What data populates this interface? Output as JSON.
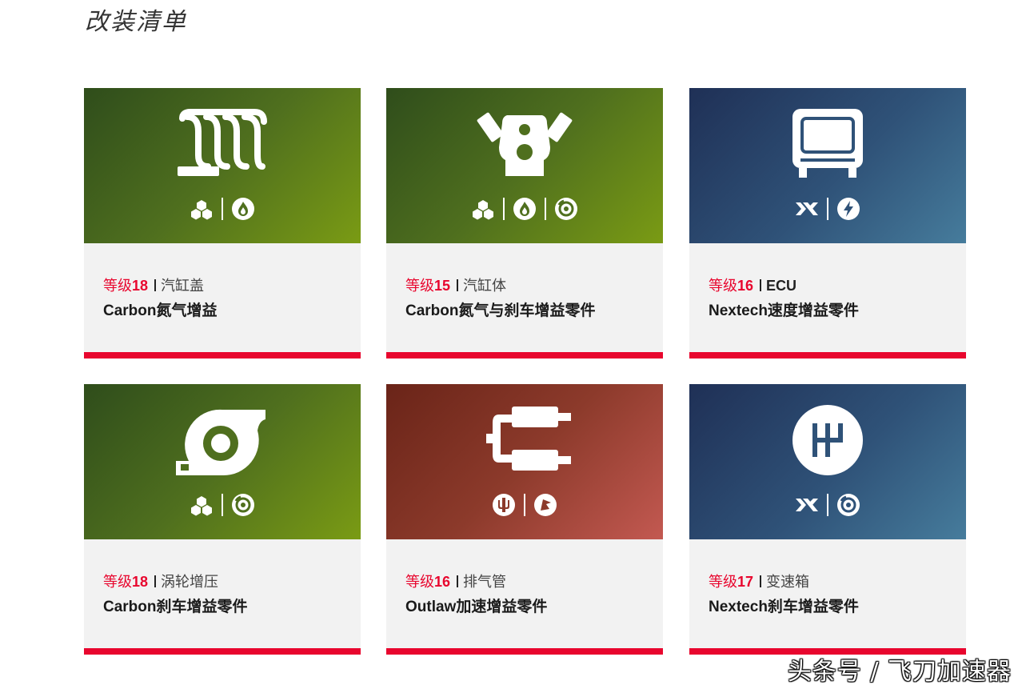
{
  "page": {
    "title": "改装清单"
  },
  "cards": [
    {
      "theme": "green",
      "tier_label": "等级",
      "tier": "18",
      "part": "汽缸盖",
      "brand": "Carbon",
      "kit": "氮气增益",
      "part_icon": "cylinder-head-icon",
      "badges": [
        "carbon-icon",
        "nitrous-icon"
      ]
    },
    {
      "theme": "green",
      "tier_label": "等级",
      "tier": "15",
      "part": "汽缸体",
      "brand": "Carbon",
      "kit": "氮气与刹车增益零件",
      "part_icon": "engine-block-icon",
      "badges": [
        "carbon-icon",
        "nitrous-icon",
        "brake-icon"
      ]
    },
    {
      "theme": "blue",
      "tier_label": "等级",
      "tier": "16",
      "part": "ECU",
      "brand": "Nextech",
      "kit": "速度增益零件",
      "part_icon": "ecu-icon",
      "badges": [
        "nextech-icon",
        "speed-icon"
      ]
    },
    {
      "theme": "green",
      "tier_label": "等级",
      "tier": "18",
      "part": "涡轮增压",
      "brand": "Carbon",
      "kit": "刹车增益零件",
      "part_icon": "turbo-icon",
      "badges": [
        "carbon-icon",
        "brake-icon"
      ]
    },
    {
      "theme": "red",
      "tier_label": "等级",
      "tier": "16",
      "part": "排气管",
      "brand": "Outlaw",
      "kit": "加速增益零件",
      "part_icon": "exhaust-icon",
      "badges": [
        "outlaw-icon",
        "acceleration-icon"
      ]
    },
    {
      "theme": "blue",
      "tier_label": "等级",
      "tier": "17",
      "part": "变速箱",
      "brand": "Nextech",
      "kit": "刹车增益零件",
      "part_icon": "gearbox-icon",
      "badges": [
        "nextech-icon",
        "brake-icon"
      ]
    }
  ],
  "colors": {
    "accent": "#e8062e",
    "green": "#4f6f1e",
    "blue": "#2f5278",
    "red": "#8c3a2b",
    "card_bg": "#f2f2f2"
  },
  "watermark": "头条号 / 飞刀加速器"
}
